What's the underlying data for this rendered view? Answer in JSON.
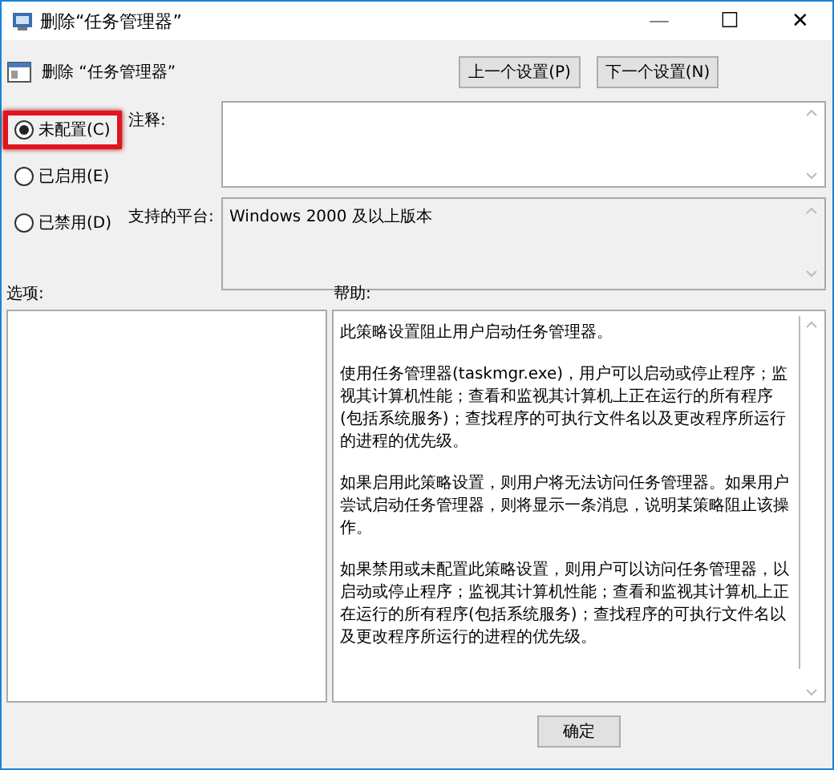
{
  "window": {
    "title": "删除“任务管理器”",
    "controls": [
      "—",
      "☐",
      "✕"
    ]
  },
  "header": {
    "title": "删除 “任务管理器”",
    "buttons": [
      "上一个设置(P)",
      "下一个设置(N)"
    ]
  },
  "options": [
    {
      "label": "未配置(C)",
      "selected": true,
      "highlighted": true
    },
    {
      "label": "已启用(E)",
      "selected": false,
      "highlighted": false
    },
    {
      "label": "已禁用(D)",
      "selected": false,
      "highlighted": false
    }
  ],
  "comment": {
    "label": "注释:"
  },
  "platform": {
    "label": "支持的平台:",
    "value": "Windows 2000 及以上版本"
  },
  "options_label": "选项:",
  "help": {
    "label": "帮助:",
    "paragraphs": [
      "此策略设置阻止用户启动任务管理器。",
      "使用任务管理器(taskmgr.exe)，用户可以启动或停止程序；监视其计算机性能；查看和监视其计算机上正在运行的所有程序(包括系统服务)；查找程序的可执行文件名以及更改程序所运行的进程的优先级。",
      "如果启用此策略设置，则用户将无法访问任务管理器。如果用户尝试启动任务管理器，则将显示一条消息，说明某策略阻止该操作。",
      "如果禁用或未配置此策略设置，则用户可以访问任务管理器，以启动或停止程序；监视其计算机性能；查看和监视其计算机上正在运行的所有程序(包括系统服务)；查找程序的可执行文件名以及更改程序所运行的进程的优先级。"
    ]
  },
  "footer": {
    "buttons": [
      "确定"
    ]
  }
}
